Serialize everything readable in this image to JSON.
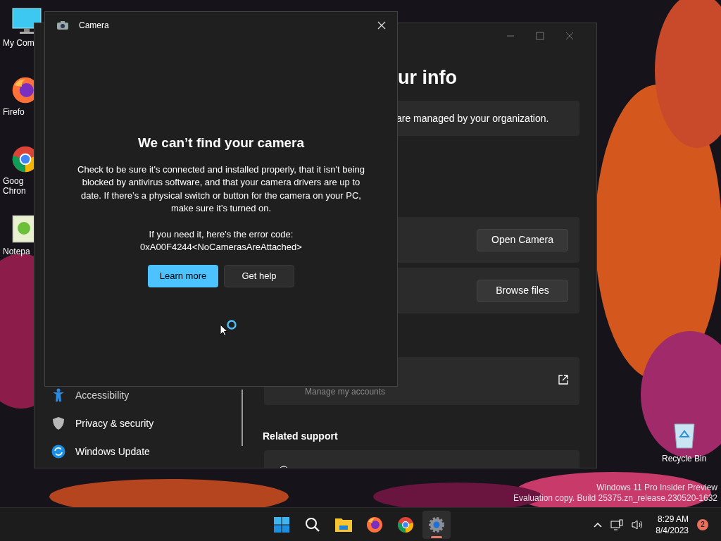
{
  "desktop_icons": [
    {
      "kind": "computer",
      "lines": [
        "My Com"
      ]
    },
    {
      "kind": "firefox",
      "lines": [
        "Firefo"
      ]
    },
    {
      "kind": "chrome",
      "lines": [
        "Goog",
        "Chron"
      ]
    },
    {
      "kind": "notepad",
      "lines": [
        "Notepa"
      ]
    }
  ],
  "recycle_bin": {
    "label": "Recycle Bin"
  },
  "settings_window": {
    "heading": "ur info",
    "notice": "are managed by your organization.",
    "cards": [
      {
        "kind": "button",
        "text": "Open Camera"
      },
      {
        "kind": "button",
        "text": "Browse files"
      },
      {
        "kind": "link",
        "text": "Manage my accounts"
      }
    ],
    "related_support": "Related support",
    "sidebar": [
      {
        "kind": "accessibility",
        "label": "Accessibility"
      },
      {
        "kind": "privacy",
        "label": "Privacy & security"
      },
      {
        "kind": "update",
        "label": "Windows Update"
      }
    ]
  },
  "camera_window": {
    "title": "Camera",
    "heading": "We can’t find your camera",
    "body": "Check to be sure it's connected and installed properly, that it isn't being blocked by antivirus software, and that your camera drivers are up to date. If there’s a physical switch or button for the camera on your PC, make sure it’s turned on.",
    "error_intro": "If you need it, here's the error code:",
    "error_code": "0xA00F4244<NoCamerasAreAttached>",
    "buttons": [
      {
        "label": "Learn more",
        "primary": true
      },
      {
        "label": "Get help",
        "primary": false
      }
    ]
  },
  "watermark": [
    "Windows 11 Pro Insider Preview",
    "Evaluation copy. Build 25375.zn_release.230520-1632"
  ],
  "taskbar": {
    "apps": [
      {
        "kind": "start",
        "active": false
      },
      {
        "kind": "search",
        "active": false
      },
      {
        "kind": "explorer",
        "active": false
      },
      {
        "kind": "firefox",
        "active": false
      },
      {
        "kind": "chrome",
        "active": false
      },
      {
        "kind": "settings",
        "active": true
      }
    ],
    "time": "8:29 AM",
    "date": "8/4/2023",
    "notifications": "2"
  }
}
